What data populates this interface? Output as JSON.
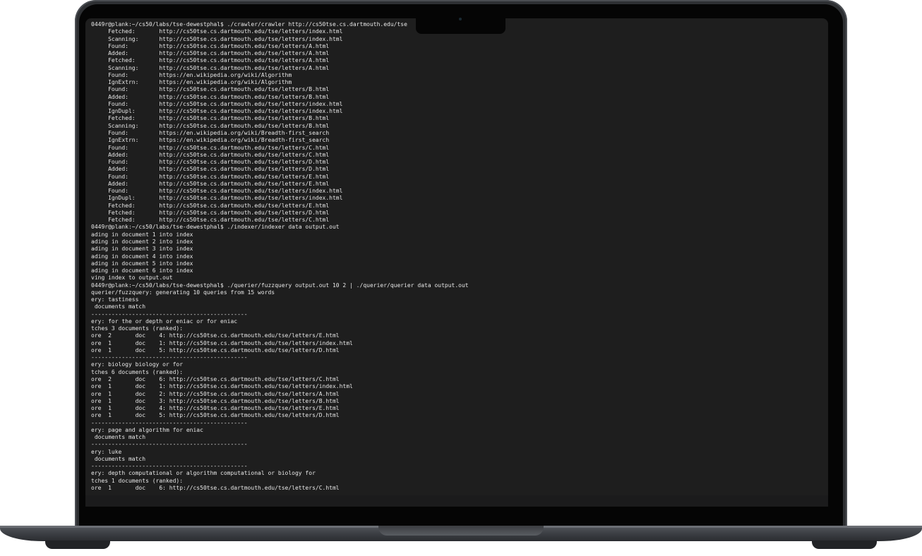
{
  "terminal": {
    "lines": [
      "0449r@plank:~/cs50/labs/tse-dewestphal$ ./crawler/crawler http://cs50tse.cs.dartmouth.edu/tse",
      "     Fetched:       http://cs50tse.cs.dartmouth.edu/tse/letters/index.html",
      "     Scanning:      http://cs50tse.cs.dartmouth.edu/tse/letters/index.html",
      "     Found:         http://cs50tse.cs.dartmouth.edu/tse/letters/A.html",
      "     Added:         http://cs50tse.cs.dartmouth.edu/tse/letters/A.html",
      "     Fetched:       http://cs50tse.cs.dartmouth.edu/tse/letters/A.html",
      "     Scanning:      http://cs50tse.cs.dartmouth.edu/tse/letters/A.html",
      "     Found:         https://en.wikipedia.org/wiki/Algorithm",
      "     IgnExtrn:      https://en.wikipedia.org/wiki/Algorithm",
      "     Found:         http://cs50tse.cs.dartmouth.edu/tse/letters/B.html",
      "     Added:         http://cs50tse.cs.dartmouth.edu/tse/letters/B.html",
      "     Found:         http://cs50tse.cs.dartmouth.edu/tse/letters/index.html",
      "     IgnDupl:       http://cs50tse.cs.dartmouth.edu/tse/letters/index.html",
      "     Fetched:       http://cs50tse.cs.dartmouth.edu/tse/letters/B.html",
      "     Scanning:      http://cs50tse.cs.dartmouth.edu/tse/letters/B.html",
      "     Found:         https://en.wikipedia.org/wiki/Breadth-first_search",
      "     IgnExtrn:      https://en.wikipedia.org/wiki/Breadth-first_search",
      "     Found:         http://cs50tse.cs.dartmouth.edu/tse/letters/C.html",
      "     Added:         http://cs50tse.cs.dartmouth.edu/tse/letters/C.html",
      "     Found:         http://cs50tse.cs.dartmouth.edu/tse/letters/D.html",
      "     Added:         http://cs50tse.cs.dartmouth.edu/tse/letters/D.html",
      "     Found:         http://cs50tse.cs.dartmouth.edu/tse/letters/E.html",
      "     Added:         http://cs50tse.cs.dartmouth.edu/tse/letters/E.html",
      "     Found:         http://cs50tse.cs.dartmouth.edu/tse/letters/index.html",
      "     IgnDupl:       http://cs50tse.cs.dartmouth.edu/tse/letters/index.html",
      "     Fetched:       http://cs50tse.cs.dartmouth.edu/tse/letters/E.html",
      "     Fetched:       http://cs50tse.cs.dartmouth.edu/tse/letters/D.html",
      "     Fetched:       http://cs50tse.cs.dartmouth.edu/tse/letters/C.html",
      "0449r@plank:~/cs50/labs/tse-dewestphal$ ./indexer/indexer data output.out",
      "ading in document 1 into index",
      "ading in document 2 into index",
      "ading in document 3 into index",
      "ading in document 4 into index",
      "ading in document 5 into index",
      "ading in document 6 into index",
      "ving index to output.out",
      "0449r@plank:~/cs50/labs/tse-dewestphal$ ./querier/fuzzquery output.out 10 2 | ./querier/querier data output.out",
      "querier/fuzzquery: generating 10 queries from 15 words",
      "ery: tastiness",
      " documents match",
      "----------------------------------------------",
      "ery: for the or depth or eniac or for eniac",
      "tches 3 documents (ranked):",
      "ore  2       doc    4: http://cs50tse.cs.dartmouth.edu/tse/letters/E.html",
      "ore  1       doc    1: http://cs50tse.cs.dartmouth.edu/tse/letters/index.html",
      "ore  1       doc    5: http://cs50tse.cs.dartmouth.edu/tse/letters/D.html",
      "----------------------------------------------",
      "ery: biology biology or for",
      "tches 6 documents (ranked):",
      "ore  2       doc    6: http://cs50tse.cs.dartmouth.edu/tse/letters/C.html",
      "ore  1       doc    1: http://cs50tse.cs.dartmouth.edu/tse/letters/index.html",
      "ore  1       doc    2: http://cs50tse.cs.dartmouth.edu/tse/letters/A.html",
      "ore  1       doc    3: http://cs50tse.cs.dartmouth.edu/tse/letters/B.html",
      "ore  1       doc    4: http://cs50tse.cs.dartmouth.edu/tse/letters/E.html",
      "ore  1       doc    5: http://cs50tse.cs.dartmouth.edu/tse/letters/D.html",
      "----------------------------------------------",
      "ery: page and algorithm for eniac",
      " documents match",
      "----------------------------------------------",
      "ery: luke",
      " documents match",
      "----------------------------------------------",
      "ery: depth computational or algorithm computational or biology for",
      "tches 1 documents (ranked):",
      "ore  1       doc    6: http://cs50tse.cs.dartmouth.edu/tse/letters/C.html"
    ]
  },
  "colors": {
    "terminal_bg": "#1e1e1e",
    "terminal_fg": "#e6e6e6",
    "device_body": "#2e3033"
  }
}
